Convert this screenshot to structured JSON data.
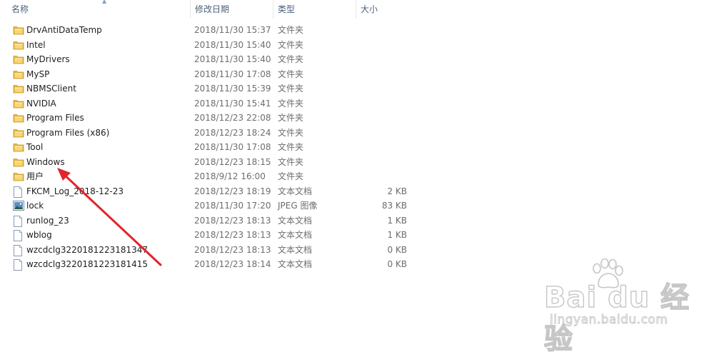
{
  "columns": {
    "name": "名称",
    "date_modified": "修改日期",
    "type": "类型",
    "size": "大小"
  },
  "files": [
    {
      "name": "DrvAntiDataTemp",
      "date": "2018/11/30 15:37",
      "type": "文件夹",
      "size": "",
      "icon": "folder-icon"
    },
    {
      "name": "Intel",
      "date": "2018/11/30 15:40",
      "type": "文件夹",
      "size": "",
      "icon": "folder-icon"
    },
    {
      "name": "MyDrivers",
      "date": "2018/11/30 15:40",
      "type": "文件夹",
      "size": "",
      "icon": "folder-icon"
    },
    {
      "name": "MySP",
      "date": "2018/11/30 17:08",
      "type": "文件夹",
      "size": "",
      "icon": "folder-icon"
    },
    {
      "name": "NBMSClient",
      "date": "2018/11/30 15:39",
      "type": "文件夹",
      "size": "",
      "icon": "folder-icon"
    },
    {
      "name": "NVIDIA",
      "date": "2018/11/30 15:41",
      "type": "文件夹",
      "size": "",
      "icon": "folder-icon"
    },
    {
      "name": "Program Files",
      "date": "2018/12/23 22:08",
      "type": "文件夹",
      "size": "",
      "icon": "folder-icon"
    },
    {
      "name": "Program Files (x86)",
      "date": "2018/12/23 18:24",
      "type": "文件夹",
      "size": "",
      "icon": "folder-icon"
    },
    {
      "name": "Tool",
      "date": "2018/11/30 17:08",
      "type": "文件夹",
      "size": "",
      "icon": "folder-icon"
    },
    {
      "name": "Windows",
      "date": "2018/12/23 18:15",
      "type": "文件夹",
      "size": "",
      "icon": "folder-icon"
    },
    {
      "name": "用户",
      "date": "2018/9/12 16:00",
      "type": "文件夹",
      "size": "",
      "icon": "folder-icon"
    },
    {
      "name": "FKCM_Log_2018-12-23",
      "date": "2018/12/23 18:19",
      "type": "文本文档",
      "size": "2 KB",
      "icon": "text-file-icon"
    },
    {
      "name": "lock",
      "date": "2018/11/30 17:20",
      "type": "JPEG 图像",
      "size": "83 KB",
      "icon": "image-file-icon"
    },
    {
      "name": "runlog_23",
      "date": "2018/12/23 18:13",
      "type": "文本文档",
      "size": "1 KB",
      "icon": "text-file-icon"
    },
    {
      "name": "wblog",
      "date": "2018/12/23 18:13",
      "type": "文本文档",
      "size": "1 KB",
      "icon": "text-file-icon"
    },
    {
      "name": "wzcdclg3220181223181347",
      "date": "2018/12/23 18:13",
      "type": "文本文档",
      "size": "0 KB",
      "icon": "text-file-icon"
    },
    {
      "name": "wzcdclg3220181223181415",
      "date": "2018/12/23 18:14",
      "type": "文本文档",
      "size": "0 KB",
      "icon": "text-file-icon"
    }
  ],
  "watermark": {
    "main": "Bai du 经验",
    "sub": "jingyan.baidu.com"
  },
  "annotation": {
    "arrow_color": "#e0252b"
  }
}
